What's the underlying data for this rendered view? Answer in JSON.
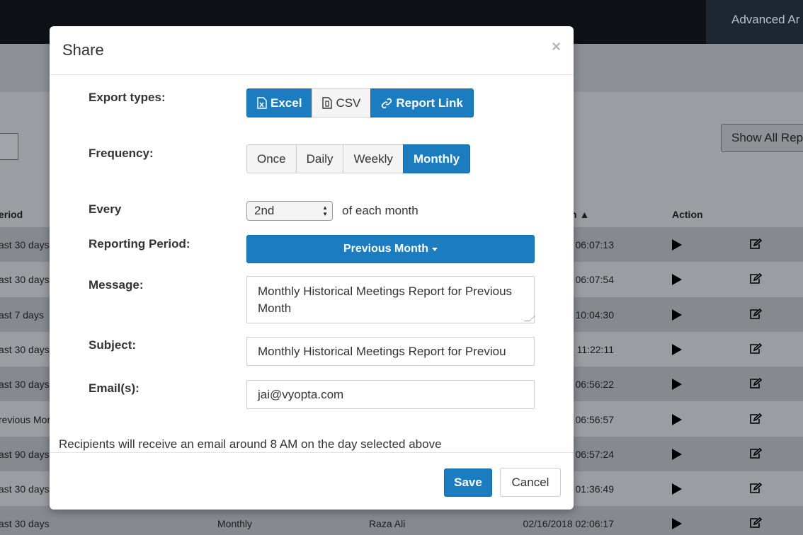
{
  "background": {
    "topbar_right_label": "Advanced Ar",
    "show_all_label": "Show All Rep",
    "columns": {
      "period": "eriod",
      "date_sorted": "n ▲",
      "action": "Action"
    },
    "rows": [
      {
        "period": "ast 30 days",
        "frequency": "",
        "owner": "",
        "time": "06:07:13"
      },
      {
        "period": "ast 30 days",
        "frequency": "",
        "owner": "",
        "time": "06:07:54"
      },
      {
        "period": "ast 7 days",
        "frequency": "",
        "owner": "",
        "time": "10:04:30"
      },
      {
        "period": "ast 30 days",
        "frequency": "",
        "owner": "",
        "time": "11:22:11"
      },
      {
        "period": "ast 30 days",
        "frequency": "",
        "owner": "",
        "time": "06:56:22"
      },
      {
        "period": "revious Mor",
        "frequency": "",
        "owner": "",
        "time": "06:56:57"
      },
      {
        "period": "ast 90 days",
        "frequency": "",
        "owner": "",
        "time": "06:57:24"
      },
      {
        "period": "ast 30 days",
        "frequency": "",
        "owner": "",
        "time": "01:36:49"
      },
      {
        "period": "ast 30 days",
        "frequency": "Monthly",
        "owner": "Raza Ali",
        "time": "02/16/2018 02:06:17"
      }
    ]
  },
  "modal": {
    "title": "Share",
    "close_symbol": "×",
    "labels": {
      "export_types": "Export types:",
      "frequency": "Frequency:",
      "every": "Every",
      "reporting_period": "Reporting Period:",
      "message": "Message:",
      "subject": "Subject:",
      "emails": "Email(s):"
    },
    "export_types": [
      {
        "label": "Excel",
        "icon": "file-excel-icon",
        "active": true
      },
      {
        "label": "CSV",
        "icon": "file-csv-icon",
        "active": false
      },
      {
        "label": "Report Link",
        "icon": "link-icon",
        "active": true
      }
    ],
    "frequencies": [
      {
        "label": "Once",
        "active": false
      },
      {
        "label": "Daily",
        "active": false
      },
      {
        "label": "Weekly",
        "active": false
      },
      {
        "label": "Monthly",
        "active": true
      }
    ],
    "every_value": "2nd",
    "every_suffix": "of each month",
    "reporting_period_value": "Previous Month",
    "message_value": "Monthly Historical  Meetings Report for Previous Month",
    "subject_value": "Monthly Historical  Meetings Report for Previou",
    "emails_value": "jai@vyopta.com",
    "note": "Recipients will receive an email around 8 AM on the day selected above",
    "save_label": "Save",
    "cancel_label": "Cancel"
  },
  "colors": {
    "primary": "#1b7cbf",
    "overlay_bg": "#9a9da1",
    "topbar": "#0e1216"
  }
}
